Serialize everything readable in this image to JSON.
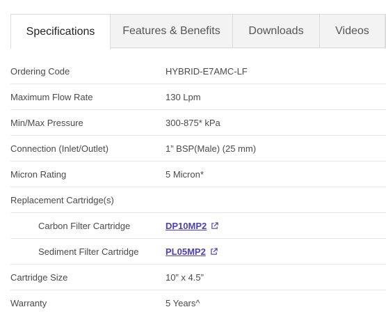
{
  "tabs": [
    {
      "label": "Specifications",
      "active": true
    },
    {
      "label": "Features & Benefits",
      "active": false
    },
    {
      "label": "Downloads",
      "active": false
    },
    {
      "label": "Videos",
      "active": false
    }
  ],
  "specs": {
    "ordering_code": {
      "label": "Ordering Code",
      "value": "HYBRID-E7AMC-LF"
    },
    "max_flow_rate": {
      "label": "Maximum Flow Rate",
      "value": "130 Lpm"
    },
    "pressure": {
      "label": "Min/Max Pressure",
      "value": "300-875* kPa"
    },
    "connection": {
      "label": "Connection (Inlet/Outlet)",
      "value": "1” BSP(Male) (25 mm)"
    },
    "micron": {
      "label": "Micron Rating",
      "value": "5 Micron*"
    },
    "replacement": {
      "label": "Replacement Cartridge(s)",
      "value": ""
    },
    "carbon": {
      "label": "Carbon Filter Cartridge",
      "value": "DP10MP2"
    },
    "sediment": {
      "label": "Sediment Filter Cartridge",
      "value": "PL05MP2"
    },
    "cartridge_size": {
      "label": "Cartridge Size",
      "value": "10” x 4.5”"
    },
    "warranty": {
      "label": "Warranty",
      "value": "5 Years^"
    }
  },
  "colors": {
    "link": "#4a3fc4",
    "tab_inactive_bg": "#f3f3f3",
    "border": "#dcdcdc"
  },
  "icons": {
    "external_link": "external-link-icon"
  }
}
